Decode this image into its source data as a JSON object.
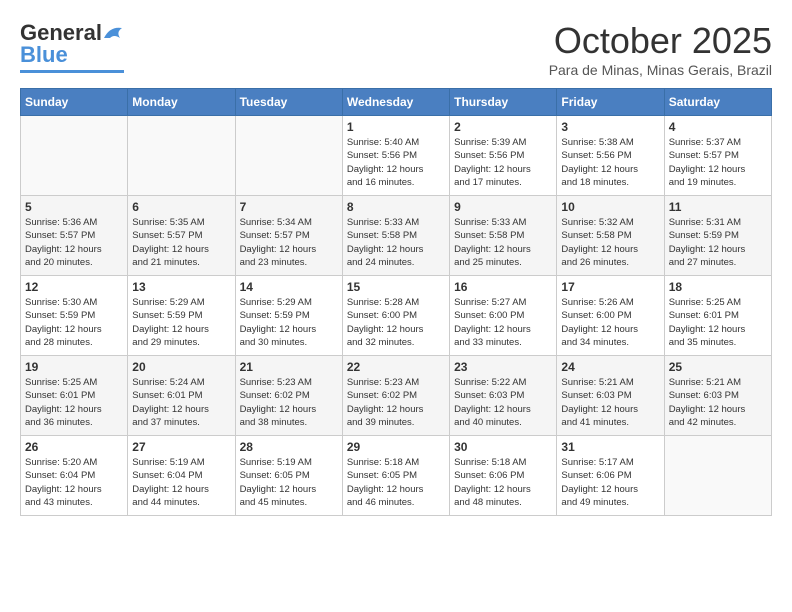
{
  "header": {
    "logo_line1": "General",
    "logo_line2": "Blue",
    "month": "October 2025",
    "location": "Para de Minas, Minas Gerais, Brazil"
  },
  "weekdays": [
    "Sunday",
    "Monday",
    "Tuesday",
    "Wednesday",
    "Thursday",
    "Friday",
    "Saturday"
  ],
  "rows": [
    [
      {
        "day": "",
        "info": ""
      },
      {
        "day": "",
        "info": ""
      },
      {
        "day": "",
        "info": ""
      },
      {
        "day": "1",
        "info": "Sunrise: 5:40 AM\nSunset: 5:56 PM\nDaylight: 12 hours\nand 16 minutes."
      },
      {
        "day": "2",
        "info": "Sunrise: 5:39 AM\nSunset: 5:56 PM\nDaylight: 12 hours\nand 17 minutes."
      },
      {
        "day": "3",
        "info": "Sunrise: 5:38 AM\nSunset: 5:56 PM\nDaylight: 12 hours\nand 18 minutes."
      },
      {
        "day": "4",
        "info": "Sunrise: 5:37 AM\nSunset: 5:57 PM\nDaylight: 12 hours\nand 19 minutes."
      }
    ],
    [
      {
        "day": "5",
        "info": "Sunrise: 5:36 AM\nSunset: 5:57 PM\nDaylight: 12 hours\nand 20 minutes."
      },
      {
        "day": "6",
        "info": "Sunrise: 5:35 AM\nSunset: 5:57 PM\nDaylight: 12 hours\nand 21 minutes."
      },
      {
        "day": "7",
        "info": "Sunrise: 5:34 AM\nSunset: 5:57 PM\nDaylight: 12 hours\nand 23 minutes."
      },
      {
        "day": "8",
        "info": "Sunrise: 5:33 AM\nSunset: 5:58 PM\nDaylight: 12 hours\nand 24 minutes."
      },
      {
        "day": "9",
        "info": "Sunrise: 5:33 AM\nSunset: 5:58 PM\nDaylight: 12 hours\nand 25 minutes."
      },
      {
        "day": "10",
        "info": "Sunrise: 5:32 AM\nSunset: 5:58 PM\nDaylight: 12 hours\nand 26 minutes."
      },
      {
        "day": "11",
        "info": "Sunrise: 5:31 AM\nSunset: 5:59 PM\nDaylight: 12 hours\nand 27 minutes."
      }
    ],
    [
      {
        "day": "12",
        "info": "Sunrise: 5:30 AM\nSunset: 5:59 PM\nDaylight: 12 hours\nand 28 minutes."
      },
      {
        "day": "13",
        "info": "Sunrise: 5:29 AM\nSunset: 5:59 PM\nDaylight: 12 hours\nand 29 minutes."
      },
      {
        "day": "14",
        "info": "Sunrise: 5:29 AM\nSunset: 5:59 PM\nDaylight: 12 hours\nand 30 minutes."
      },
      {
        "day": "15",
        "info": "Sunrise: 5:28 AM\nSunset: 6:00 PM\nDaylight: 12 hours\nand 32 minutes."
      },
      {
        "day": "16",
        "info": "Sunrise: 5:27 AM\nSunset: 6:00 PM\nDaylight: 12 hours\nand 33 minutes."
      },
      {
        "day": "17",
        "info": "Sunrise: 5:26 AM\nSunset: 6:00 PM\nDaylight: 12 hours\nand 34 minutes."
      },
      {
        "day": "18",
        "info": "Sunrise: 5:25 AM\nSunset: 6:01 PM\nDaylight: 12 hours\nand 35 minutes."
      }
    ],
    [
      {
        "day": "19",
        "info": "Sunrise: 5:25 AM\nSunset: 6:01 PM\nDaylight: 12 hours\nand 36 minutes."
      },
      {
        "day": "20",
        "info": "Sunrise: 5:24 AM\nSunset: 6:01 PM\nDaylight: 12 hours\nand 37 minutes."
      },
      {
        "day": "21",
        "info": "Sunrise: 5:23 AM\nSunset: 6:02 PM\nDaylight: 12 hours\nand 38 minutes."
      },
      {
        "day": "22",
        "info": "Sunrise: 5:23 AM\nSunset: 6:02 PM\nDaylight: 12 hours\nand 39 minutes."
      },
      {
        "day": "23",
        "info": "Sunrise: 5:22 AM\nSunset: 6:03 PM\nDaylight: 12 hours\nand 40 minutes."
      },
      {
        "day": "24",
        "info": "Sunrise: 5:21 AM\nSunset: 6:03 PM\nDaylight: 12 hours\nand 41 minutes."
      },
      {
        "day": "25",
        "info": "Sunrise: 5:21 AM\nSunset: 6:03 PM\nDaylight: 12 hours\nand 42 minutes."
      }
    ],
    [
      {
        "day": "26",
        "info": "Sunrise: 5:20 AM\nSunset: 6:04 PM\nDaylight: 12 hours\nand 43 minutes."
      },
      {
        "day": "27",
        "info": "Sunrise: 5:19 AM\nSunset: 6:04 PM\nDaylight: 12 hours\nand 44 minutes."
      },
      {
        "day": "28",
        "info": "Sunrise: 5:19 AM\nSunset: 6:05 PM\nDaylight: 12 hours\nand 45 minutes."
      },
      {
        "day": "29",
        "info": "Sunrise: 5:18 AM\nSunset: 6:05 PM\nDaylight: 12 hours\nand 46 minutes."
      },
      {
        "day": "30",
        "info": "Sunrise: 5:18 AM\nSunset: 6:06 PM\nDaylight: 12 hours\nand 48 minutes."
      },
      {
        "day": "31",
        "info": "Sunrise: 5:17 AM\nSunset: 6:06 PM\nDaylight: 12 hours\nand 49 minutes."
      },
      {
        "day": "",
        "info": ""
      }
    ]
  ]
}
